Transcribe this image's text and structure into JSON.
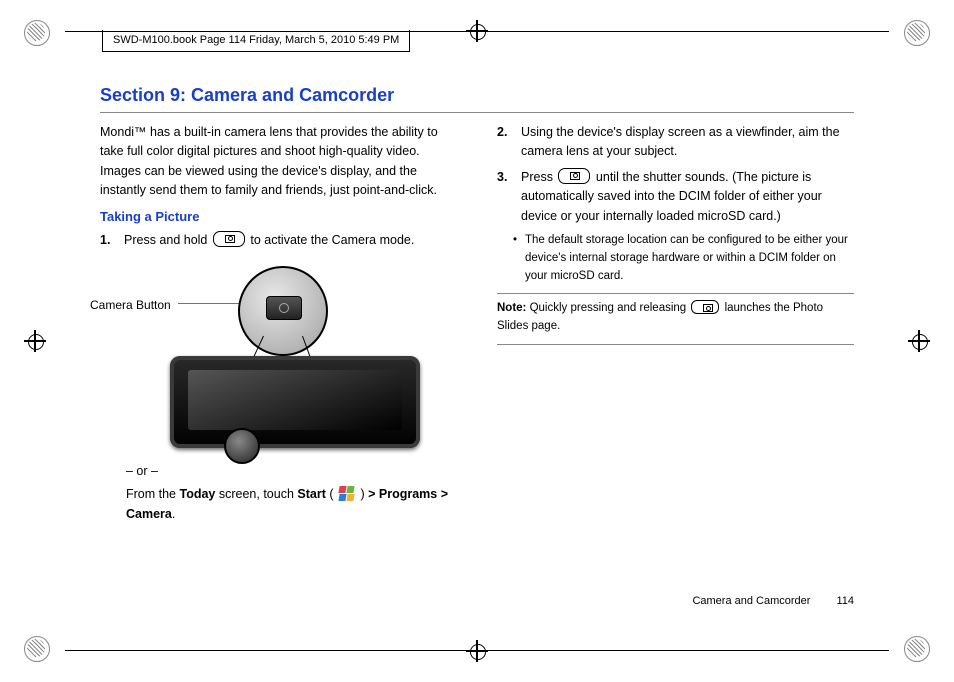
{
  "header_line": "SWD-M100.book  Page 114  Friday, March 5, 2010  5:49 PM",
  "section_title": "Section 9: Camera and Camcorder",
  "intro": "Mondi™ has a built-in camera lens that provides the ability to take full color digital pictures and shoot high-quality video. Images can be viewed using the device's display, and the instantly send them to family and friends, just point-and-click.",
  "sub_heading": "Taking a Picture",
  "step1_num": "1.",
  "step1_a": "Press and hold ",
  "step1_b": " to activate the Camera mode.",
  "diagram_label": "Camera Button",
  "or_text": "– or –",
  "alt_a": "From the ",
  "alt_today": "Today",
  "alt_b": " screen, touch ",
  "alt_start": "Start",
  "alt_c": " ( ",
  "alt_d": " ) ",
  "alt_programs": "> Programs > Camera",
  "alt_end": ".",
  "step2_num": "2.",
  "step2_text": "Using the device's display screen as a viewfinder, aim the camera lens at your subject.",
  "step3_num": "3.",
  "step3_a": "Press ",
  "step3_b": " until the shutter sounds. (The picture is automatically saved into the DCIM folder of either your device or your internally loaded microSD card.)",
  "step3_bullet": "The default storage location can be configured to be either your device's internal storage hardware or within a DCIM folder on your microSD card.",
  "note_lbl": "Note:",
  "note_a": " Quickly pressing and releasing ",
  "note_b": " launches the Photo Slides page.",
  "footer_section": "Camera and Camcorder",
  "footer_page": "114"
}
